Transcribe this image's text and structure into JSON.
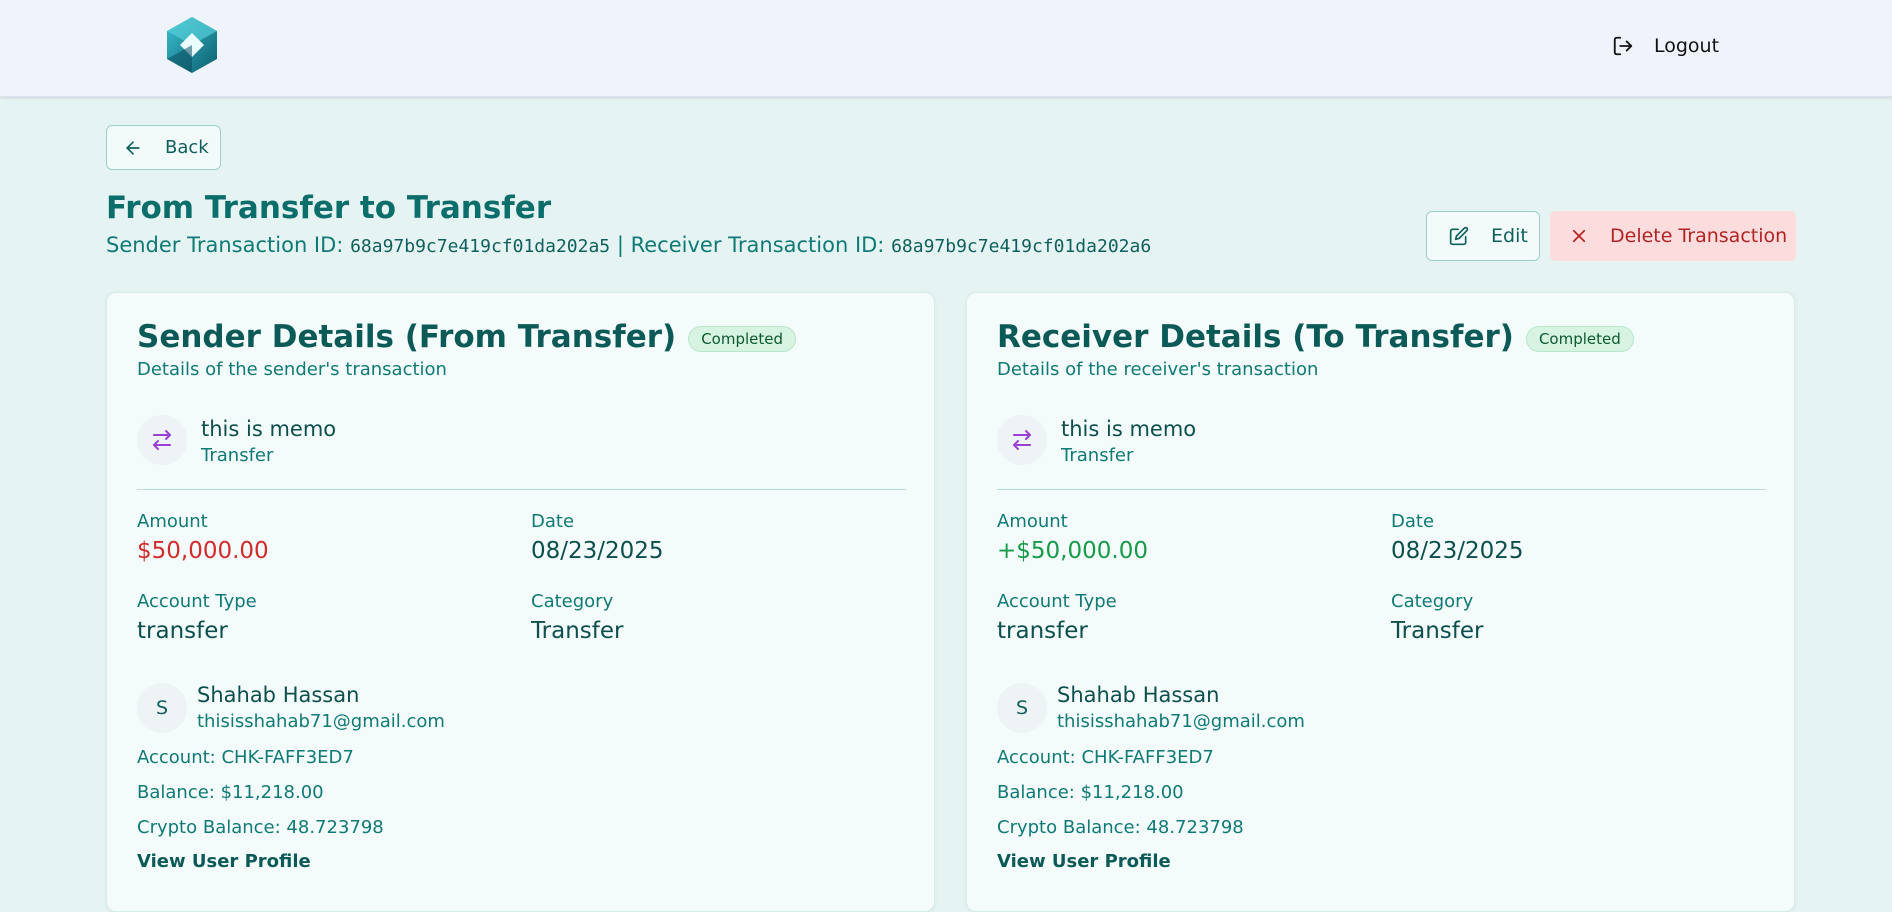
{
  "header": {
    "logo_icon": "hexagon-cube-logo",
    "logout_label": "Logout"
  },
  "back_label": "Back",
  "page": {
    "title": "From Transfer to Transfer",
    "sender_id_label": "Sender Transaction ID:",
    "sender_id": "68a97b9c7e419cf01da202a5",
    "separator": "|",
    "receiver_id_label": "Receiver Transaction ID:",
    "receiver_id": "68a97b9c7e419cf01da202a6"
  },
  "actions": {
    "edit_label": "Edit",
    "delete_label": "Delete Transaction"
  },
  "sender": {
    "title": "Sender Details (From Transfer)",
    "status": "Completed",
    "description": "Details of the sender's transaction",
    "memo": "this is memo",
    "memo_type": "Transfer",
    "amount_label": "Amount",
    "amount": "$50,000.00",
    "date_label": "Date",
    "date": "08/23/2025",
    "account_type_label": "Account Type",
    "account_type": "transfer",
    "category_label": "Category",
    "category": "Transfer",
    "avatar_initial": "S",
    "user_name": "Shahab Hassan",
    "user_email": "thisisshahab71@gmail.com",
    "account": "Account: CHK-FAFF3ED7",
    "balance": "Balance: $11,218.00",
    "crypto_balance": "Crypto Balance: 48.723798",
    "profile_link": "View User Profile"
  },
  "receiver": {
    "title": "Receiver Details (To Transfer)",
    "status": "Completed",
    "description": "Details of the receiver's transaction",
    "memo": "this is memo",
    "memo_type": "Transfer",
    "amount_label": "Amount",
    "amount": "+$50,000.00",
    "date_label": "Date",
    "date": "08/23/2025",
    "account_type_label": "Account Type",
    "account_type": "transfer",
    "category_label": "Category",
    "category": "Transfer",
    "avatar_initial": "S",
    "user_name": "Shahab Hassan",
    "user_email": "thisisshahab71@gmail.com",
    "account": "Account: CHK-FAFF3ED7",
    "balance": "Balance: $11,218.00",
    "crypto_balance": "Crypto Balance: 48.723798",
    "profile_link": "View User Profile"
  },
  "colors": {
    "accent": "#0b6e6b",
    "debit": "#d12b2b",
    "credit": "#179b4a",
    "badge_bg": "#d7f3e2",
    "delete_bg": "#fcdcdc"
  }
}
